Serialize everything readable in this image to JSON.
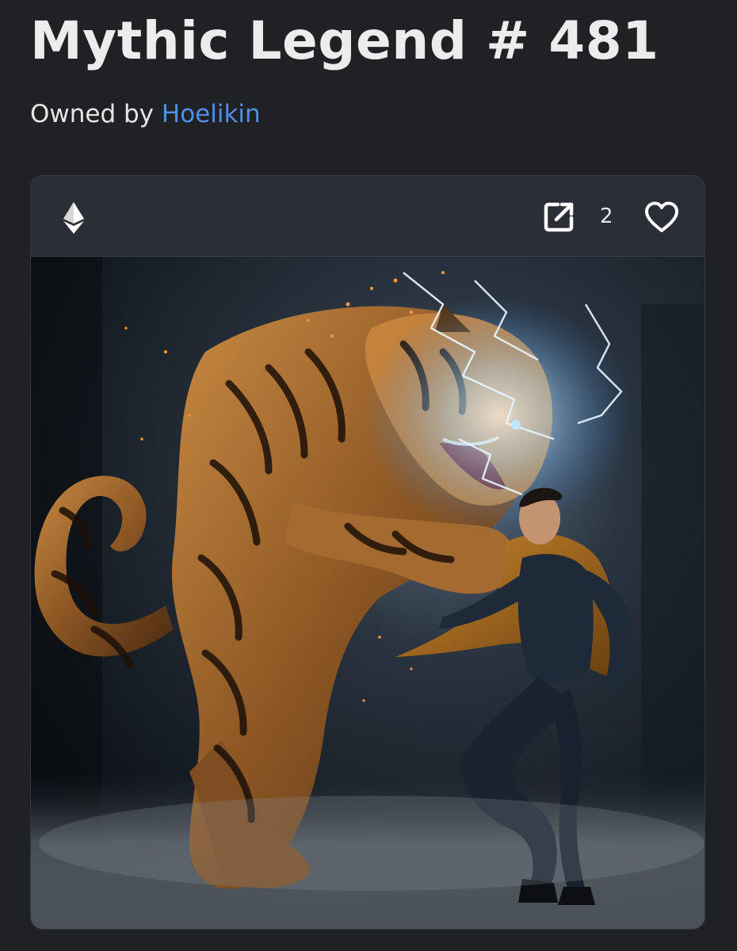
{
  "header": {
    "title": "Mythic Legend # 481",
    "owned_by_label": "Owned by",
    "owner_name": "Hoelikin"
  },
  "card": {
    "currency_icon": "ethereum-icon",
    "external_link_icon": "external-link-icon",
    "like_icon": "heart-outline-icon",
    "like_count": "2"
  },
  "colors": {
    "background": "#202124",
    "card_background": "#2a2d33",
    "owner_link": "#4f8fe8",
    "text": "#ececec"
  }
}
